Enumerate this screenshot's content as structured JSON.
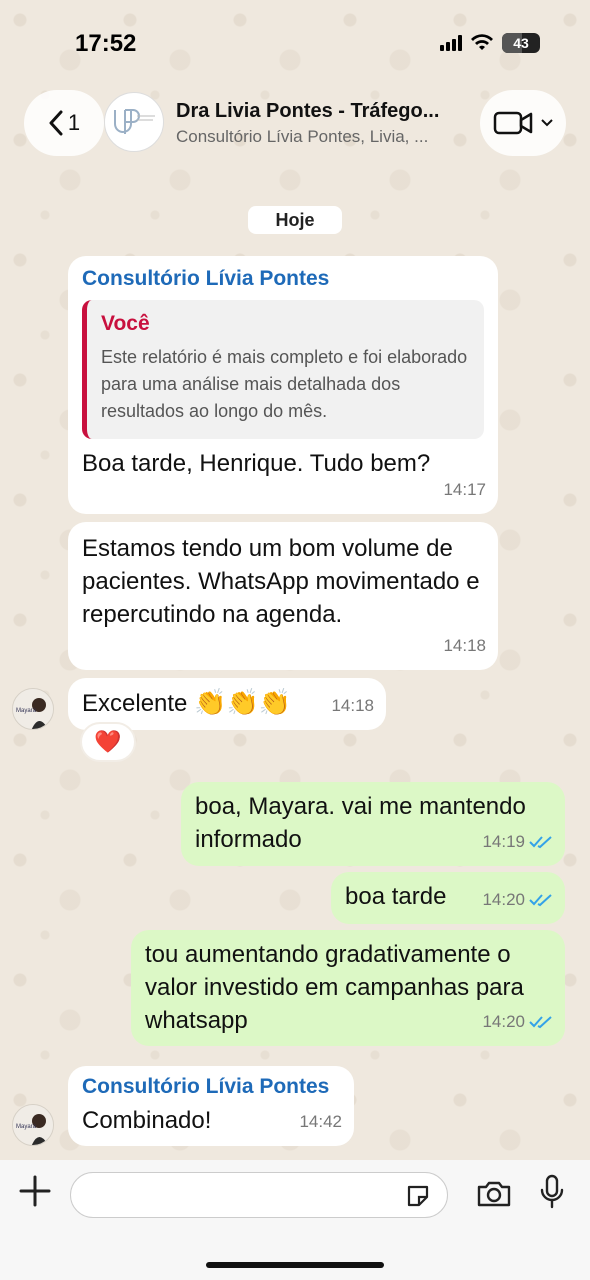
{
  "status_bar": {
    "time": "17:52",
    "battery": "43"
  },
  "header": {
    "back_count": "1",
    "title": "Dra Livia Pontes - Tráfego...",
    "subtitle": "Consultório Lívia Pontes, Livia, ..."
  },
  "date_chip": "Hoje",
  "messages": [
    {
      "sender": "Consultório Lívia Pontes",
      "quote_author": "Você",
      "quote_text": "Este relatório é mais completo e foi elaborado para uma análise mais detalhada dos resultados ao longo do mês.",
      "text": "Boa tarde, Henrique. Tudo bem?",
      "time": "14:17"
    },
    {
      "text": "Estamos tendo um bom volume de pacientes. WhatsApp movimentado e repercutindo na agenda.",
      "time": "14:18"
    },
    {
      "text": "Excelente",
      "emojis": "👏👏👏",
      "time": "14:18",
      "reaction": "❤️"
    },
    {
      "text": "boa, Mayara. vai me mantendo informado",
      "time": "14:19",
      "status": "read"
    },
    {
      "text": "boa tarde",
      "time": "14:20",
      "status": "read"
    },
    {
      "text": "tou aumentando gradativamente o valor investido em campanhas para whatsapp",
      "time": "14:20",
      "status": "read"
    },
    {
      "sender": "Consultório Lívia Pontes",
      "text": "Combinado!",
      "time": "14:42"
    }
  ],
  "colors": {
    "outgoing": "#dcf8c6",
    "incoming": "#ffffff",
    "sender_name": "#1e6ab8",
    "quote_bar": "#c8103e",
    "read_ticks": "#34a2e8"
  },
  "icons": [
    "back-chevron-icon",
    "video-call-icon",
    "plus-icon",
    "sticker-icon",
    "camera-icon",
    "microphone-icon"
  ]
}
